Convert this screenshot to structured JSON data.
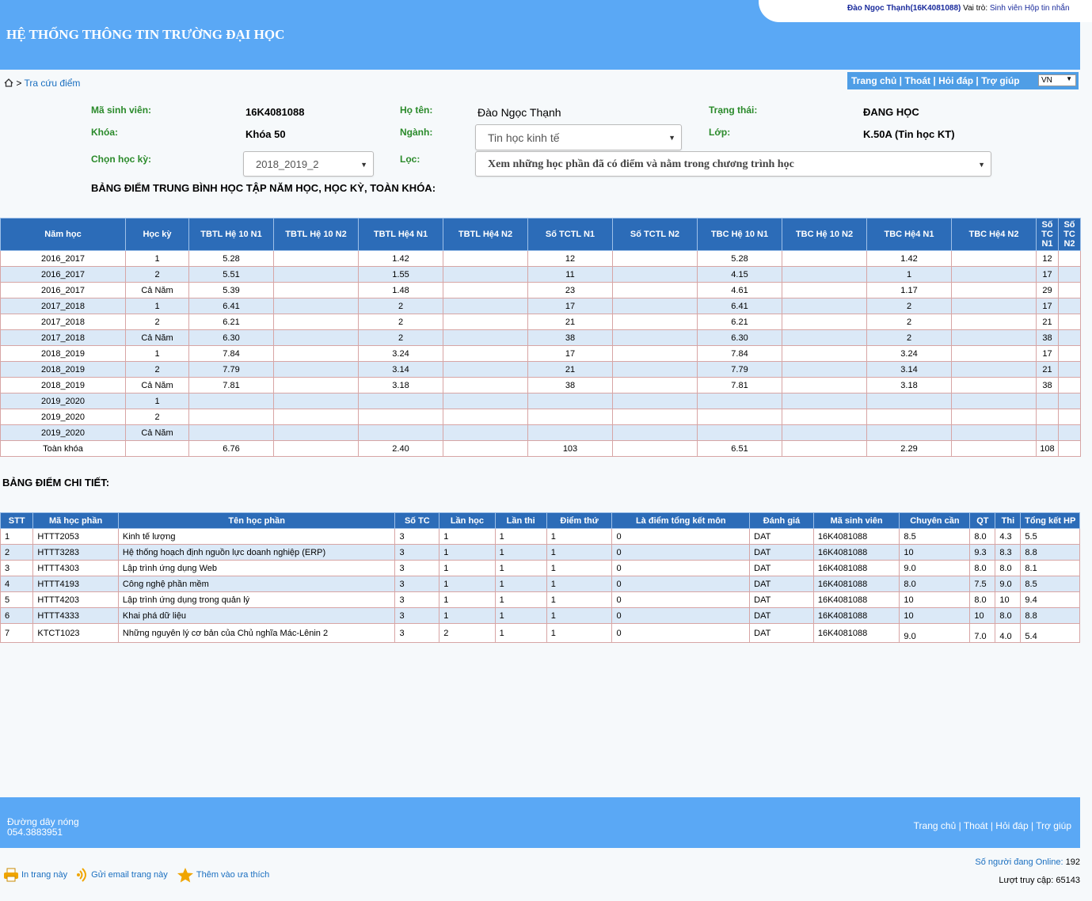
{
  "header": {
    "title": "HỆ THỐNG THÔNG TIN TRƯỜNG ĐẠI HỌC",
    "user_name": "Đào Ngọc Thạnh(16K4081088)",
    "role_label": "Vai trò:",
    "role_value": "Sinh viên",
    "inbox_link": "Hộp tin nhắn"
  },
  "breadcrumb": {
    "current": "Tra cứu điểm"
  },
  "topnav": {
    "home": "Trang chủ",
    "logout": "Thoát",
    "faq": "Hỏi đáp",
    "help": "Trợ giúp",
    "sep": " | ",
    "language": "VN"
  },
  "student": {
    "id_label": "Mã sinh viên:",
    "id": "16K4081088",
    "name_label": "Họ tên:",
    "name": "Đào Ngọc Thạnh",
    "status_label": "Trạng thái:",
    "status": "ĐANG HỌC",
    "course_label": "Khóa:",
    "course": "Khóa 50",
    "major_label": "Ngành:",
    "major": "Tin học kinh tế",
    "class_label": "Lớp:",
    "class": "K.50A (Tin học KT)",
    "semester_label": "Chọn học kỳ:",
    "semester": "2018_2019_2",
    "filter_label": "Lọc:",
    "filter": "Xem những học phần đã có điểm và nằm trong chương trình học"
  },
  "summary": {
    "title": "BẢNG ĐIỂM TRUNG BÌNH HỌC TẬP NĂM HỌC, HỌC KỲ, TOÀN KHÓA:",
    "headers": [
      "Năm học",
      "Học kỳ",
      "TBTL Hệ 10 N1",
      "TBTL Hệ 10 N2",
      "TBTL Hệ4 N1",
      "TBTL Hệ4 N2",
      "Số TCTL N1",
      "Số TCTL N2",
      "TBC Hệ 10 N1",
      "TBC Hệ 10 N2",
      "TBC Hệ4 N1",
      "TBC Hệ4 N2",
      "Số TC N1",
      "Số TC N2"
    ],
    "rows": [
      [
        "2016_2017",
        "1",
        "5.28",
        "",
        "1.42",
        "",
        "12",
        "",
        "5.28",
        "",
        "1.42",
        "",
        "12",
        ""
      ],
      [
        "2016_2017",
        "2",
        "5.51",
        "",
        "1.55",
        "",
        "11",
        "",
        "4.15",
        "",
        "1",
        "",
        "17",
        ""
      ],
      [
        "2016_2017",
        "Cả Năm",
        "5.39",
        "",
        "1.48",
        "",
        "23",
        "",
        "4.61",
        "",
        "1.17",
        "",
        "29",
        ""
      ],
      [
        "2017_2018",
        "1",
        "6.41",
        "",
        "2",
        "",
        "17",
        "",
        "6.41",
        "",
        "2",
        "",
        "17",
        ""
      ],
      [
        "2017_2018",
        "2",
        "6.21",
        "",
        "2",
        "",
        "21",
        "",
        "6.21",
        "",
        "2",
        "",
        "21",
        ""
      ],
      [
        "2017_2018",
        "Cả Năm",
        "6.30",
        "",
        "2",
        "",
        "38",
        "",
        "6.30",
        "",
        "2",
        "",
        "38",
        ""
      ],
      [
        "2018_2019",
        "1",
        "7.84",
        "",
        "3.24",
        "",
        "17",
        "",
        "7.84",
        "",
        "3.24",
        "",
        "17",
        ""
      ],
      [
        "2018_2019",
        "2",
        "7.79",
        "",
        "3.14",
        "",
        "21",
        "",
        "7.79",
        "",
        "3.14",
        "",
        "21",
        ""
      ],
      [
        "2018_2019",
        "Cả Năm",
        "7.81",
        "",
        "3.18",
        "",
        "38",
        "",
        "7.81",
        "",
        "3.18",
        "",
        "38",
        ""
      ],
      [
        "2019_2020",
        "1",
        "",
        "",
        "",
        "",
        "",
        "",
        "",
        "",
        "",
        "",
        "",
        ""
      ],
      [
        "2019_2020",
        "2",
        "",
        "",
        "",
        "",
        "",
        "",
        "",
        "",
        "",
        "",
        "",
        ""
      ],
      [
        "2019_2020",
        "Cả Năm",
        "",
        "",
        "",
        "",
        "",
        "",
        "",
        "",
        "",
        "",
        "",
        ""
      ],
      [
        "Toàn khóa",
        "",
        "6.76",
        "",
        "2.40",
        "",
        "103",
        "",
        "6.51",
        "",
        "2.29",
        "",
        "108",
        ""
      ]
    ]
  },
  "detail": {
    "title": "BẢNG ĐIỂM CHI TIẾT:",
    "headers": [
      "STT",
      "Mã học phần",
      "Tên học phần",
      "Số TC",
      "Lần học",
      "Lần thi",
      "Điểm thứ",
      "Là điểm tổng kết môn",
      "Đánh giá",
      "Mã sinh viên",
      "Chuyên cần",
      "QT",
      "Thi",
      "Tổng kết HP"
    ],
    "rows": [
      [
        "1",
        "HTTT2053",
        "Kinh tế lượng",
        "3",
        "1",
        "1",
        "1",
        "0",
        "DAT",
        "16K4081088",
        "8.5",
        "8.0",
        "4.3",
        "5.5"
      ],
      [
        "2",
        "HTTT3283",
        "Hệ thống hoạch định nguồn lực doanh nghiệp (ERP)",
        "3",
        "1",
        "1",
        "1",
        "0",
        "DAT",
        "16K4081088",
        "10",
        "9.3",
        "8.3",
        "8.8"
      ],
      [
        "3",
        "HTTT4303",
        "Lập trình ứng dụng Web",
        "3",
        "1",
        "1",
        "1",
        "0",
        "DAT",
        "16K4081088",
        "9.0",
        "8.0",
        "8.0",
        "8.1"
      ],
      [
        "4",
        "HTTT4193",
        "Công nghệ phần mềm",
        "3",
        "1",
        "1",
        "1",
        "0",
        "DAT",
        "16K4081088",
        "8.0",
        "7.5",
        "9.0",
        "8.5"
      ],
      [
        "5",
        "HTTT4203",
        "Lập trình ứng dụng trong quản lý",
        "3",
        "1",
        "1",
        "1",
        "0",
        "DAT",
        "16K4081088",
        "10",
        "8.0",
        "10",
        "9.4"
      ],
      [
        "6",
        "HTTT4333",
        "Khai phá dữ liệu",
        "3",
        "1",
        "1",
        "1",
        "0",
        "DAT",
        "16K4081088",
        "10",
        "10",
        "8.0",
        "8.8"
      ],
      [
        "7",
        "KTCT1023",
        "Những nguyên lý cơ bản của Chủ nghĩa Mác-Lênin 2",
        "3",
        "2",
        "1",
        "1",
        "0",
        "DAT",
        "16K4081088",
        "9.0",
        "7.0",
        "4.0",
        "5.4"
      ]
    ]
  },
  "footer": {
    "hotline_label": "Đường dây nóng",
    "hotline": "054.3883951",
    "links_text": "Trang chủ | Thoát | Hỏi đáp | Trợ giúp"
  },
  "tools": {
    "print": "In trang này",
    "email": "Gửi email trang này",
    "favorite": "Thêm vào ưa thích"
  },
  "stats": {
    "online_label": "Số người đang Online:",
    "online": "192",
    "visits_label": "Lượt truy cập:",
    "visits": "65143"
  }
}
